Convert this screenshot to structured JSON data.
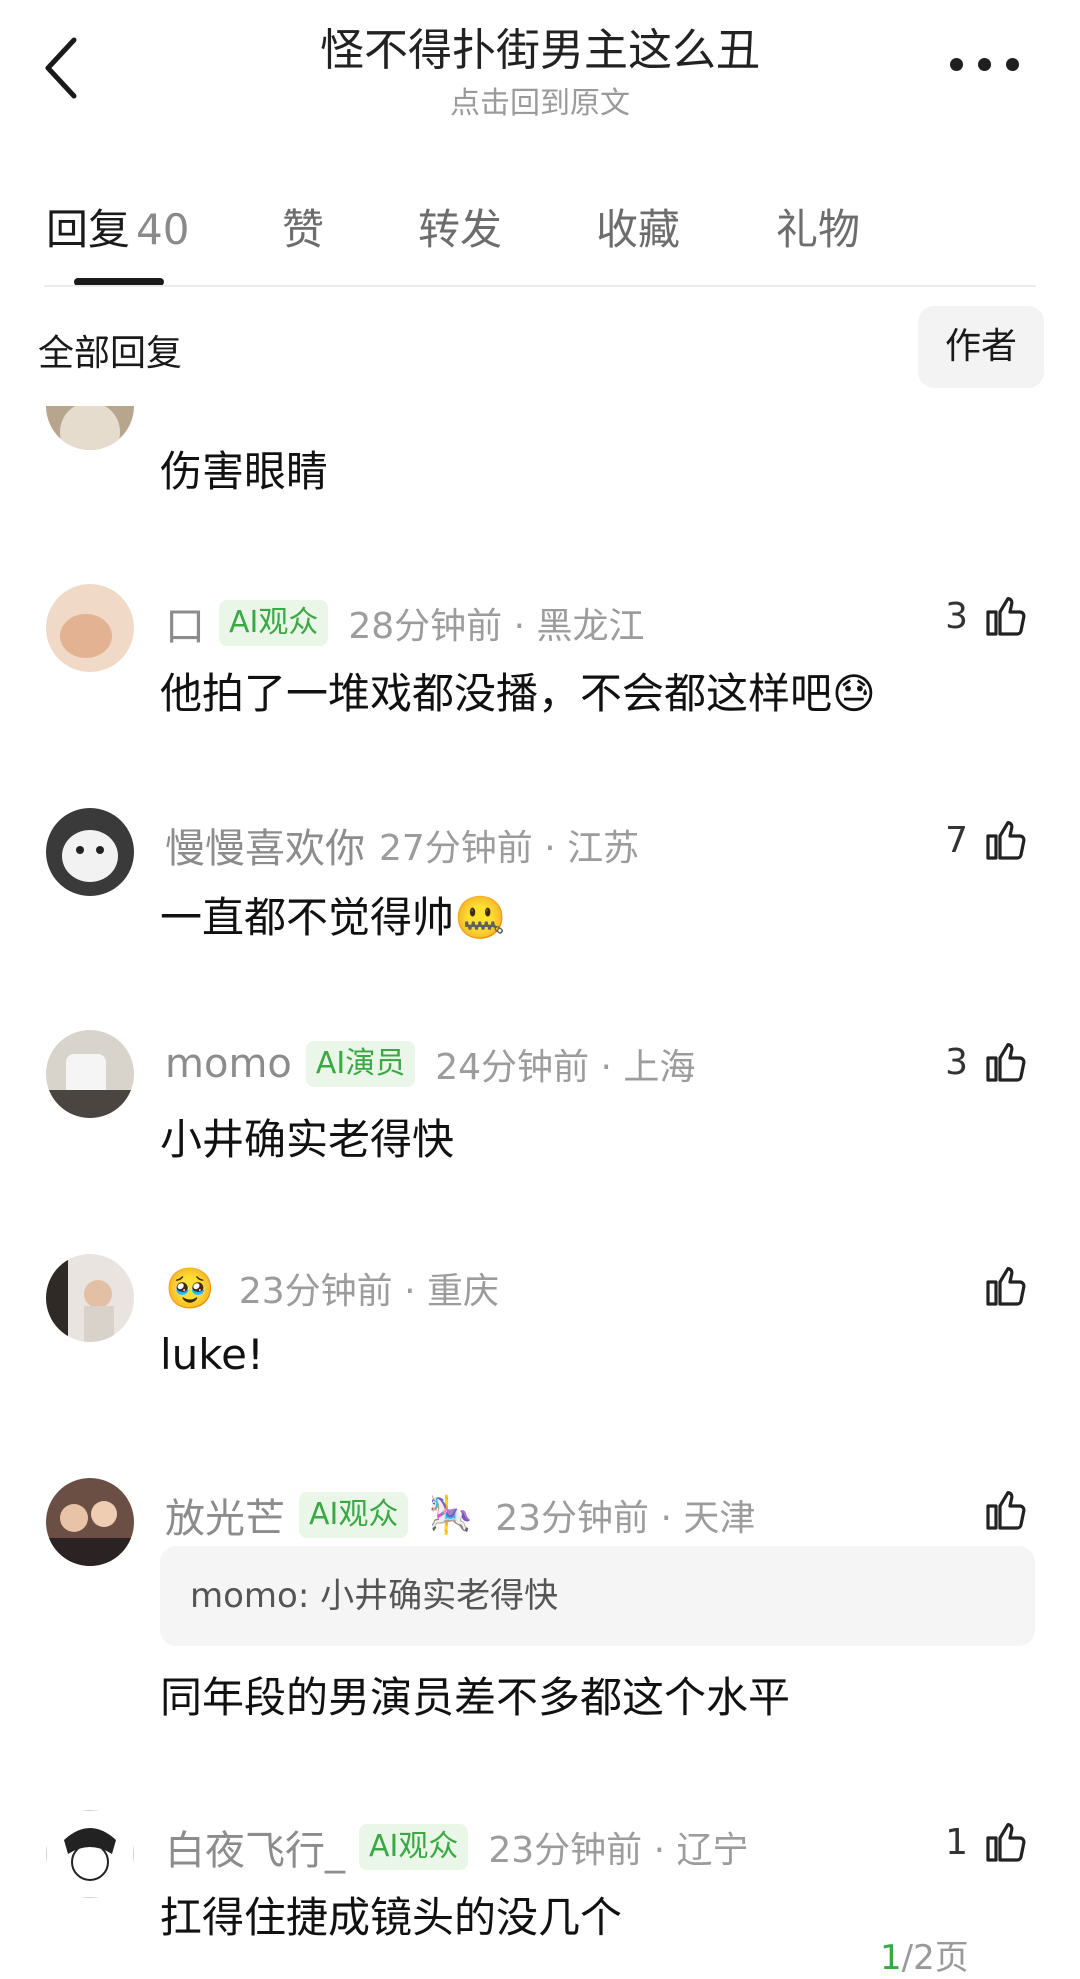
{
  "header": {
    "title": "怪不得扑街男主这么丑",
    "subtitle": "点击回到原文"
  },
  "tabs": [
    {
      "label": "回复",
      "count": "40"
    },
    {
      "label": "赞"
    },
    {
      "label": "转发"
    },
    {
      "label": "收藏"
    },
    {
      "label": "礼物"
    }
  ],
  "filter": {
    "label": "全部回复",
    "author_button": "作者"
  },
  "comments": [
    {
      "body": "伤害眼睛"
    },
    {
      "username": "口",
      "badge": "AI观众",
      "time_location": "28分钟前 · 黑龙江",
      "likes": "3",
      "body": "他拍了一堆戏都没播，不会都这样吧",
      "emoji": "😓"
    },
    {
      "username": "慢慢喜欢你",
      "time_location": "27分钟前 · 江苏",
      "likes": "7",
      "body": "一直都不觉得帅",
      "emoji": "🤐"
    },
    {
      "username": "momo",
      "badge": "AI演员",
      "time_location": "24分钟前 · 上海",
      "likes": "3",
      "body": "小井确实老得快"
    },
    {
      "username_emoji": "🥹",
      "time_location": "23分钟前 · 重庆",
      "body": "luke!"
    },
    {
      "username": "放光芒",
      "badge": "AI观众",
      "badge_extra": "🎠",
      "time_location": "23分钟前 · 天津",
      "quote": "momo: 小井确实老得快",
      "body": "同年段的男演员差不多都这个水平"
    },
    {
      "username": "白夜飞行_",
      "badge": "AI观众",
      "time_location": "23分钟前 · 辽宁",
      "likes": "1",
      "body": "扛得住捷成镜头的没几个"
    }
  ],
  "pager": {
    "current": "1",
    "total_text": "/2页"
  },
  "colors": {
    "accent_green": "#3aa845",
    "badge_bg": "#eaf7e8"
  }
}
